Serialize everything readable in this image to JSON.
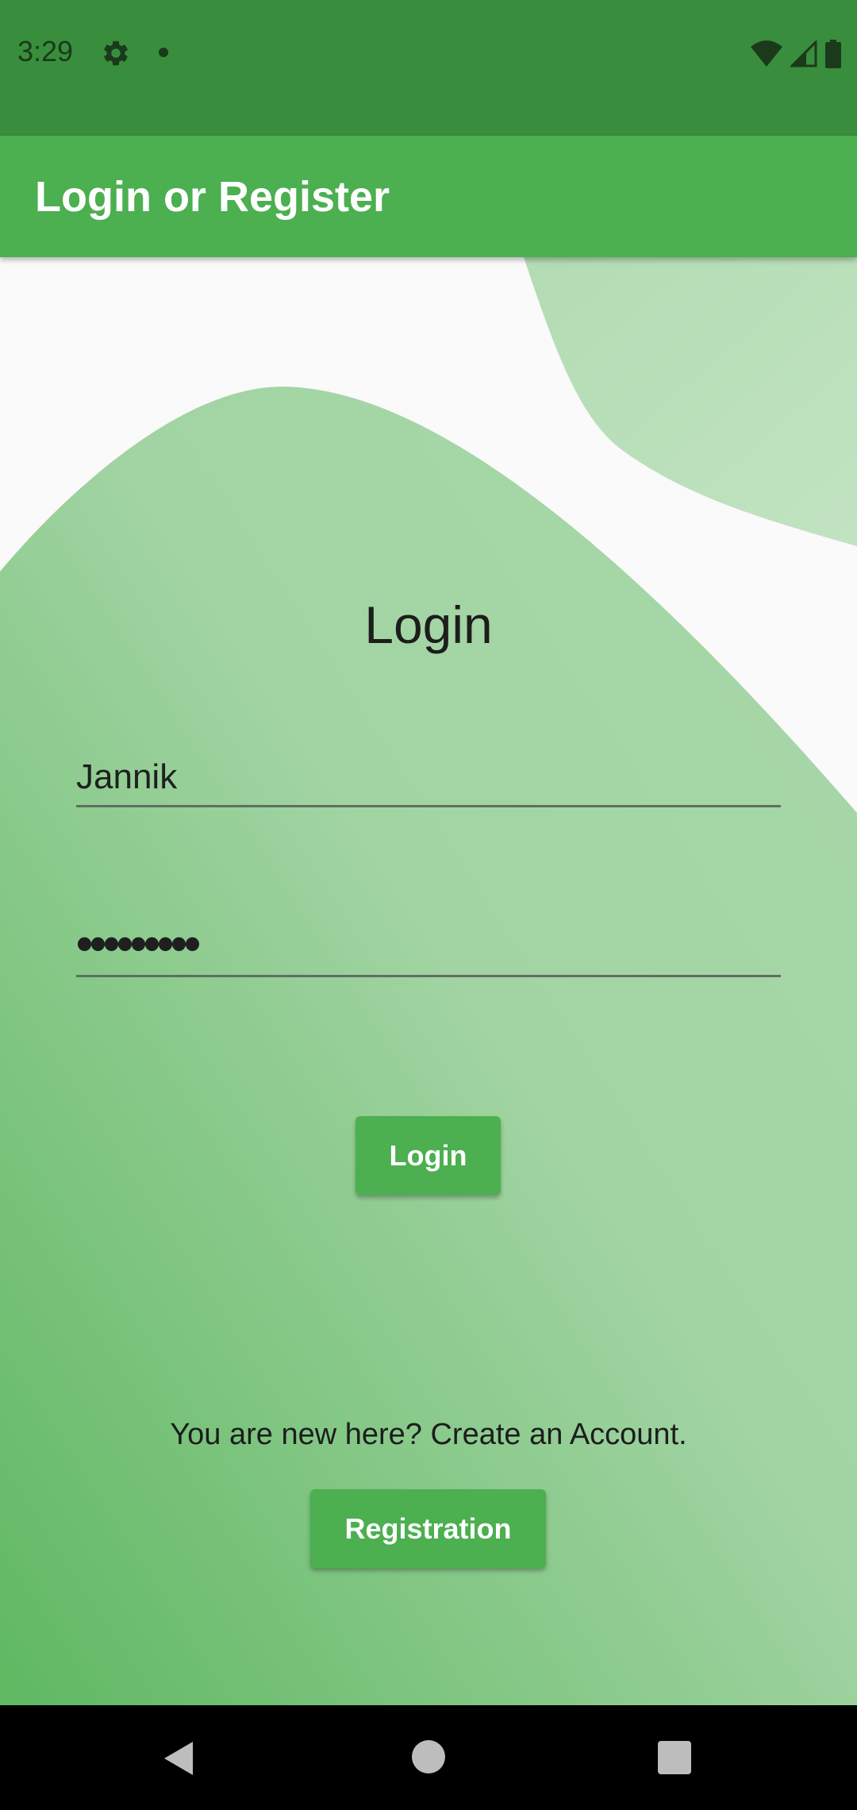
{
  "status_bar": {
    "time": "3:29",
    "icons": [
      "settings-gear-icon",
      "notification-dot-icon",
      "wifi-icon",
      "cell-signal-icon",
      "battery-icon"
    ],
    "bg_color": "#388e3c"
  },
  "app_bar": {
    "title": "Login or Register",
    "bg_color": "#4caf50"
  },
  "login": {
    "heading": "Login",
    "username_value": "Jannik",
    "password_value": "•••••••••",
    "login_button_label": "Login"
  },
  "register": {
    "prompt": "You are new here? Create an Account.",
    "button_label": "Registration"
  },
  "nav_bar": {
    "icons": [
      "back-icon",
      "home-icon",
      "recents-icon"
    ]
  },
  "colors": {
    "accent": "#4caf50",
    "status_bar": "#388e3c",
    "wave_light": "#b9dfb9",
    "wave_main_top": "#a5d6a7",
    "wave_main_bottom": "#66bb6a"
  }
}
